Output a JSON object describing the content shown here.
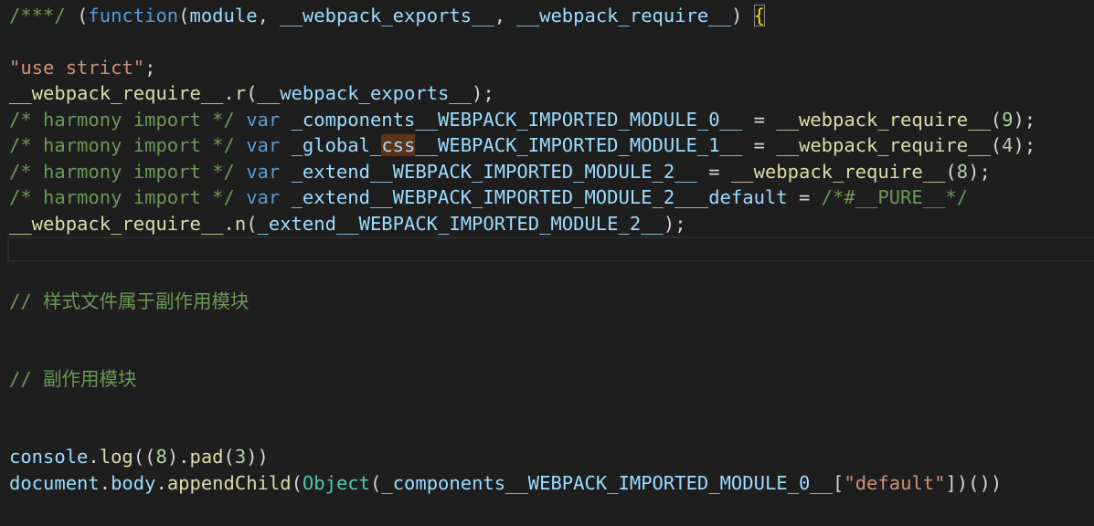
{
  "colors": {
    "background": "#1e1e1e",
    "comment": "#6a9955",
    "keyword": "#569cd6",
    "string": "#ce9178",
    "function": "#dcdcaa",
    "variable": "#9cdcfe",
    "class": "#4ec9b0",
    "number": "#b5cea8",
    "plain": "#d4d4d4",
    "bracket": "#ffd700",
    "find_highlight": "#613214"
  },
  "editor": {
    "lines": [
      [
        {
          "t": "/***/ ",
          "c": "comment"
        },
        {
          "t": "(",
          "c": "plain"
        },
        {
          "t": "function",
          "c": "keyword"
        },
        {
          "t": "(",
          "c": "plain"
        },
        {
          "t": "module",
          "c": "var"
        },
        {
          "t": ", ",
          "c": "plain"
        },
        {
          "t": "__webpack_exports__",
          "c": "var"
        },
        {
          "t": ", ",
          "c": "plain"
        },
        {
          "t": "__webpack_require__",
          "c": "var"
        },
        {
          "t": ") ",
          "c": "plain"
        },
        {
          "t": "{",
          "c": "bracket",
          "x": "match"
        }
      ],
      [],
      [
        {
          "t": "\"use strict\"",
          "c": "string"
        },
        {
          "t": ";",
          "c": "plain"
        }
      ],
      [
        {
          "t": "__webpack_require__",
          "c": "function"
        },
        {
          "t": ".",
          "c": "plain"
        },
        {
          "t": "r",
          "c": "function"
        },
        {
          "t": "(",
          "c": "plain"
        },
        {
          "t": "__webpack_exports__",
          "c": "var"
        },
        {
          "t": ");",
          "c": "plain"
        }
      ],
      [
        {
          "t": "/* harmony import */ ",
          "c": "comment"
        },
        {
          "t": "var ",
          "c": "keyword"
        },
        {
          "t": "_components__WEBPACK_IMPORTED_MODULE_0__",
          "c": "var"
        },
        {
          "t": " = ",
          "c": "plain"
        },
        {
          "t": "__webpack_require__",
          "c": "function"
        },
        {
          "t": "(",
          "c": "plain"
        },
        {
          "t": "9",
          "c": "number"
        },
        {
          "t": ");",
          "c": "plain"
        }
      ],
      [
        {
          "t": "/* harmony import */ ",
          "c": "comment"
        },
        {
          "t": "var ",
          "c": "keyword"
        },
        {
          "t": "_global_",
          "c": "var"
        },
        {
          "t": "css",
          "c": "var",
          "x": "find"
        },
        {
          "t": "__WEBPACK_IMPORTED_MODULE_1__",
          "c": "var"
        },
        {
          "t": " = ",
          "c": "plain"
        },
        {
          "t": "__webpack_require__",
          "c": "function"
        },
        {
          "t": "(",
          "c": "plain"
        },
        {
          "t": "4",
          "c": "number"
        },
        {
          "t": ");",
          "c": "plain"
        }
      ],
      [
        {
          "t": "/* harmony import */ ",
          "c": "comment"
        },
        {
          "t": "var ",
          "c": "keyword"
        },
        {
          "t": "_extend__WEBPACK_IMPORTED_MODULE_2__",
          "c": "var"
        },
        {
          "t": " = ",
          "c": "plain"
        },
        {
          "t": "__webpack_require__",
          "c": "function"
        },
        {
          "t": "(",
          "c": "plain"
        },
        {
          "t": "8",
          "c": "number"
        },
        {
          "t": ");",
          "c": "plain"
        }
      ],
      [
        {
          "t": "/* harmony import */ ",
          "c": "comment"
        },
        {
          "t": "var ",
          "c": "keyword"
        },
        {
          "t": "_extend__WEBPACK_IMPORTED_MODULE_2___default",
          "c": "var"
        },
        {
          "t": " = ",
          "c": "plain"
        },
        {
          "t": "/*#__PURE__*/",
          "c": "comment"
        }
      ],
      [
        {
          "t": "__webpack_require__",
          "c": "function"
        },
        {
          "t": ".",
          "c": "plain"
        },
        {
          "t": "n",
          "c": "function"
        },
        {
          "t": "(",
          "c": "plain"
        },
        {
          "t": "_extend__WEBPACK_IMPORTED_MODULE_2__",
          "c": "var"
        },
        {
          "t": ");",
          "c": "plain"
        }
      ],
      [],
      [],
      [
        {
          "t": "// 样式文件属于副作用模块",
          "c": "comment"
        }
      ],
      [],
      [],
      [
        {
          "t": "// 副作用模块",
          "c": "comment"
        }
      ],
      [],
      [],
      [
        {
          "t": "console",
          "c": "var"
        },
        {
          "t": ".",
          "c": "plain"
        },
        {
          "t": "log",
          "c": "function"
        },
        {
          "t": "((",
          "c": "plain"
        },
        {
          "t": "8",
          "c": "number"
        },
        {
          "t": ").",
          "c": "plain"
        },
        {
          "t": "pad",
          "c": "function"
        },
        {
          "t": "(",
          "c": "plain"
        },
        {
          "t": "3",
          "c": "number"
        },
        {
          "t": "))",
          "c": "plain"
        }
      ],
      [
        {
          "t": "document",
          "c": "var"
        },
        {
          "t": ".",
          "c": "plain"
        },
        {
          "t": "body",
          "c": "var"
        },
        {
          "t": ".",
          "c": "plain"
        },
        {
          "t": "appendChild",
          "c": "function"
        },
        {
          "t": "(",
          "c": "plain"
        },
        {
          "t": "Object",
          "c": "class"
        },
        {
          "t": "(",
          "c": "plain"
        },
        {
          "t": "_components__WEBPACK_IMPORTED_MODULE_0__",
          "c": "var"
        },
        {
          "t": "[",
          "c": "plain"
        },
        {
          "t": "\"default\"",
          "c": "string"
        },
        {
          "t": "])())",
          "c": "plain"
        }
      ]
    ],
    "current_line_index": 9
  }
}
